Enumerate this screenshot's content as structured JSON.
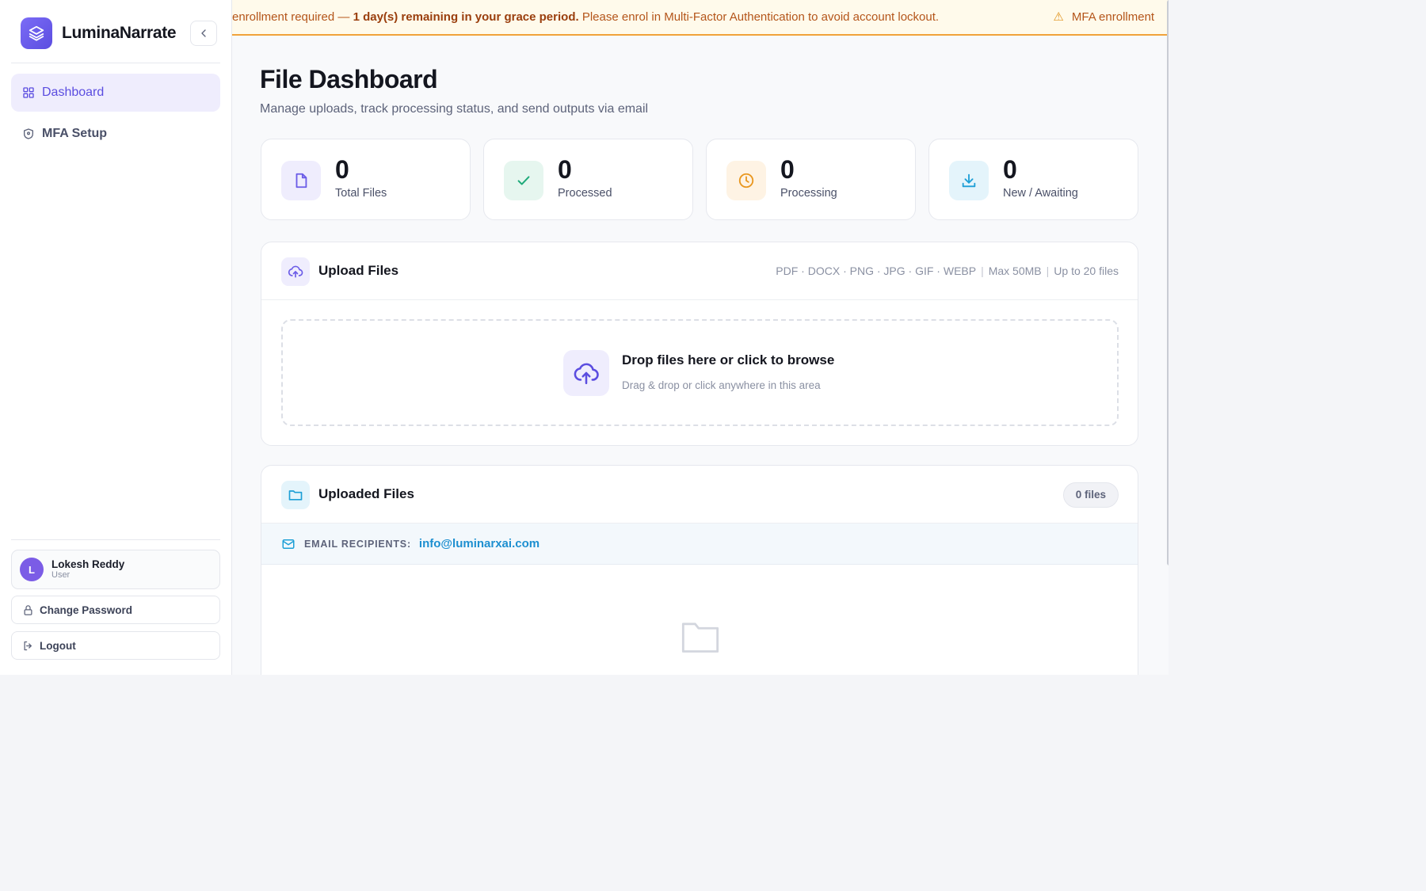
{
  "app": {
    "name": "LuminaNarrate"
  },
  "sidebar": {
    "items": [
      {
        "label": "Dashboard",
        "icon": "grid-icon",
        "active": true
      },
      {
        "label": "MFA Setup",
        "icon": "shield-icon",
        "active": false
      }
    ],
    "user": {
      "initial": "L",
      "name": "Lokesh Reddy",
      "role": "User"
    },
    "change_password_label": "Change Password",
    "logout_label": "Logout"
  },
  "banner": {
    "lead_partial": "enrollment required — ",
    "emphasis": "1 day(s) remaining in your grace period.",
    "rest": " Please enrol in Multi-Factor Authentication to avoid account lockout.",
    "repeat_partial": "MFA enrollment",
    "warning_icon": "warning-icon"
  },
  "page": {
    "title": "File Dashboard",
    "subtitle": "Manage uploads, track processing status, and send outputs via email"
  },
  "stats": [
    {
      "value": "0",
      "label": "Total Files",
      "icon": "file-icon",
      "color": "#6b5ce7",
      "bg": "#efedfd"
    },
    {
      "value": "0",
      "label": "Processed",
      "icon": "check-icon",
      "color": "#1faa7a",
      "bg": "#e6f6ef"
    },
    {
      "value": "0",
      "label": "Processing",
      "icon": "clock-icon",
      "color": "#e9971f",
      "bg": "#fef3e4"
    },
    {
      "value": "0",
      "label": "New / Awaiting",
      "icon": "download-icon",
      "color": "#1d9fd6",
      "bg": "#e4f4fb"
    }
  ],
  "upload": {
    "title": "Upload Files",
    "formats": "PDF · DOCX · PNG · JPG · GIF · WEBP",
    "max_size": "Max 50MB",
    "max_files": "Up to 20 files",
    "drop_title": "Drop files here or click to browse",
    "drop_sub": "Drag & drop or click anywhere in this area"
  },
  "uploaded": {
    "title": "Uploaded Files",
    "count_label": "0 files",
    "recipients_label": "EMAIL RECIPIENTS:",
    "recipients_email": "info@luminarxai.com"
  },
  "colors": {
    "accent": "#5b4de0",
    "banner_bg": "#fffaeb",
    "banner_border": "#f0a23a",
    "link": "#1d8fd0"
  }
}
